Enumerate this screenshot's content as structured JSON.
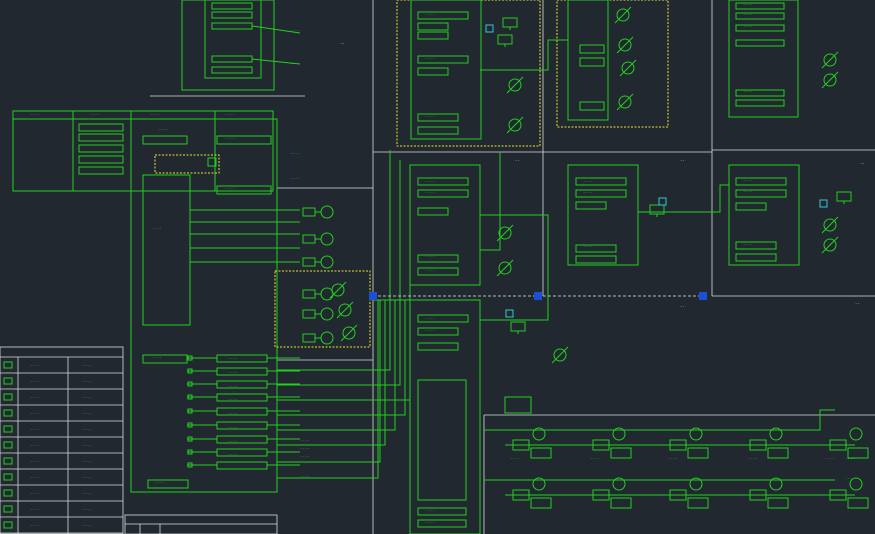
{
  "colors": {
    "background": "#212830",
    "wire": "#22d11e",
    "frame": "#d9dde0",
    "highlight": "#e8e032",
    "cyan": "#33c7d6",
    "grip": "#1a4fd6"
  },
  "labels": {
    "tiny": "----",
    "mid": "--",
    "short": "-"
  }
}
